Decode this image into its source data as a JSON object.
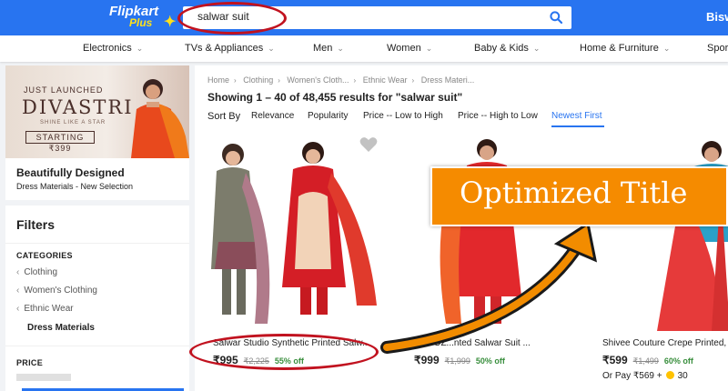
{
  "header": {
    "logo_line1": "Flipkart",
    "logo_line2": "Plus",
    "search_value": "salwar suit",
    "user_label": "Bisw"
  },
  "nav": {
    "items": [
      {
        "label": "Electronics",
        "chevron": true
      },
      {
        "label": "TVs & Appliances",
        "chevron": true
      },
      {
        "label": "Men",
        "chevron": true
      },
      {
        "label": "Women",
        "chevron": true
      },
      {
        "label": "Baby & Kids",
        "chevron": true
      },
      {
        "label": "Home & Furniture",
        "chevron": true
      },
      {
        "label": "Spor",
        "chevron": false
      }
    ]
  },
  "promo": {
    "small": "JUST LAUNCHED",
    "brand": "DIVASTRI",
    "tagline": "SHINE LIKE A STAR",
    "cta": "STARTING ₹399",
    "title": "Beautifully Designed",
    "subtitle": "Dress Materials - New Selection"
  },
  "filters": {
    "title": "Filters",
    "categories_heading": "CATEGORIES",
    "categories": [
      "Clothing",
      "Women's Clothing",
      "Ethnic Wear"
    ],
    "current": "Dress Materials",
    "price_heading": "PRICE"
  },
  "breadcrumb": [
    "Home",
    "Clothing",
    "Women's Cloth...",
    "Ethnic Wear",
    "Dress Materi..."
  ],
  "results_text": "Showing 1 – 40 of 48,455 results for \"salwar suit\"",
  "sort": {
    "label": "Sort By",
    "options": [
      "Relevance",
      "Popularity",
      "Price -- Low to High",
      "Price -- High to Low",
      "Newest First"
    ],
    "active_index": 4
  },
  "products": [
    {
      "title": "Salwar Studio Synthetic Printed Salw...",
      "price": "₹995",
      "mrp": "₹2,225",
      "discount": "55% off",
      "extra": ""
    },
    {
      "title": "AMPOZ...nted Salwar Suit ...",
      "price": "₹999",
      "mrp": "₹1,999",
      "discount": "50% off",
      "extra": ""
    },
    {
      "title": "Shivee Couture Crepe Printed,",
      "price": "₹599",
      "mrp": "₹1,499",
      "discount": "60% off",
      "extra": "Or Pay ₹569 +",
      "coins": "30"
    }
  ],
  "overlay": {
    "banner_text": "Optimized Title"
  },
  "colors": {
    "brand_blue": "#2874f0",
    "accent_yellow": "#ffe11b",
    "discount_green": "#388e3c",
    "annotation_red": "#c1121f",
    "banner_orange": "#f58b00"
  }
}
